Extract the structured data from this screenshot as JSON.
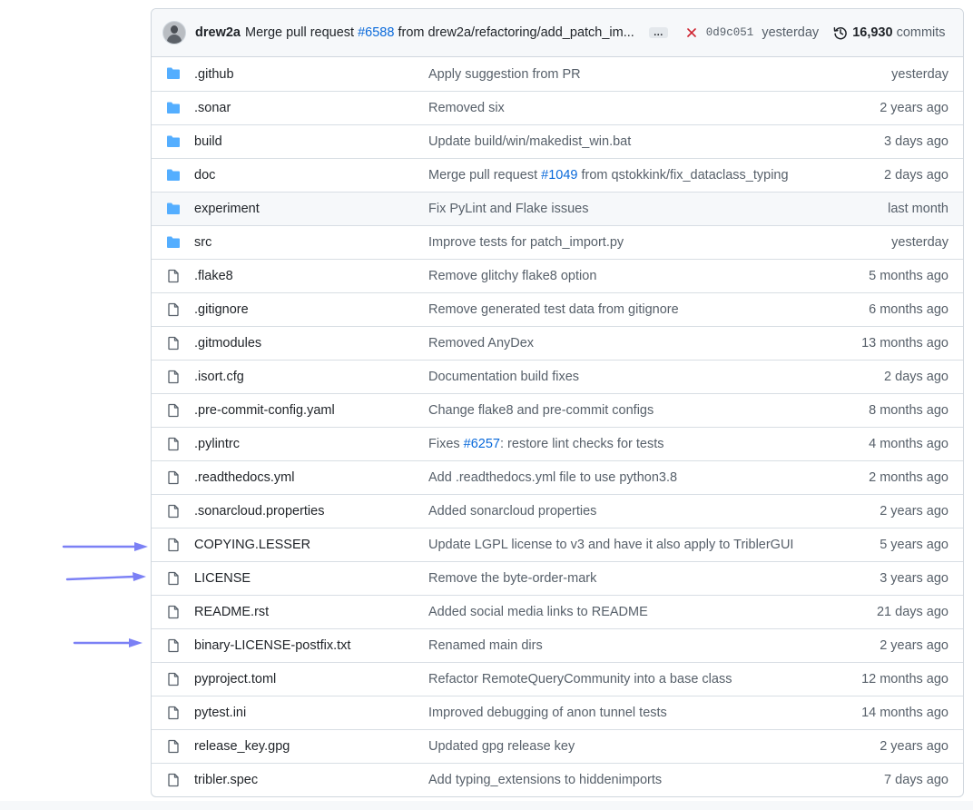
{
  "colors": {
    "folder": "#54aeff",
    "link": "#0969da",
    "arrow": "#7b80f5",
    "fail": "#cf222e"
  },
  "commit_bar": {
    "author": "drew2a",
    "message_prefix": "Merge pull request",
    "pr_link": "#6588",
    "message_suffix": "from drew2a/refactoring/add_patch_im...",
    "expand": "…",
    "status_icon": "x-icon",
    "sha": "0d9c051",
    "when": "yesterday",
    "history_icon": "history-icon",
    "commit_count": "16,930",
    "commits_label": "commits"
  },
  "files": [
    {
      "type": "dir",
      "name": ".github",
      "message": "Apply suggestion from PR",
      "age": "yesterday"
    },
    {
      "type": "dir",
      "name": ".sonar",
      "message": "Removed six",
      "age": "2 years ago"
    },
    {
      "type": "dir",
      "name": "build",
      "message": "Update build/win/makedist_win.bat",
      "age": "3 days ago"
    },
    {
      "type": "dir",
      "name": "doc",
      "message_prefix": "Merge pull request ",
      "message_link": "#1049",
      "message_suffix": " from qstokkink/fix_dataclass_typing",
      "age": "2 days ago"
    },
    {
      "type": "dir",
      "name": "experiment",
      "message": "Fix PyLint and Flake issues",
      "age": "last month"
    },
    {
      "type": "dir",
      "name": "src",
      "message": "Improve tests for patch_import.py",
      "age": "yesterday"
    },
    {
      "type": "file",
      "name": ".flake8",
      "message": "Remove glitchy flake8 option",
      "age": "5 months ago"
    },
    {
      "type": "file",
      "name": ".gitignore",
      "message": "Remove generated test data from gitignore",
      "age": "6 months ago"
    },
    {
      "type": "file",
      "name": ".gitmodules",
      "message": "Removed AnyDex",
      "age": "13 months ago"
    },
    {
      "type": "file",
      "name": ".isort.cfg",
      "message": "Documentation build fixes",
      "age": "2 days ago"
    },
    {
      "type": "file",
      "name": ".pre-commit-config.yaml",
      "message": "Change flake8 and pre-commit configs",
      "age": "8 months ago"
    },
    {
      "type": "file",
      "name": ".pylintrc",
      "message_prefix": "Fixes ",
      "message_link": "#6257",
      "message_suffix": ": restore lint checks for tests",
      "age": "4 months ago"
    },
    {
      "type": "file",
      "name": ".readthedocs.yml",
      "message": "Add .readthedocs.yml file to use python3.8",
      "age": "2 months ago"
    },
    {
      "type": "file",
      "name": ".sonarcloud.properties",
      "message": "Added sonarcloud properties",
      "age": "2 years ago"
    },
    {
      "type": "file",
      "name": "COPYING.LESSER",
      "message": "Update LGPL license to v3 and have it also apply to TriblerGUI",
      "age": "5 years ago"
    },
    {
      "type": "file",
      "name": "LICENSE",
      "message": "Remove the byte-order-mark",
      "age": "3 years ago"
    },
    {
      "type": "file",
      "name": "README.rst",
      "message": "Added social media links to README",
      "age": "21 days ago"
    },
    {
      "type": "file",
      "name": "binary-LICENSE-postfix.txt",
      "message": "Renamed main dirs",
      "age": "2 years ago"
    },
    {
      "type": "file",
      "name": "pyproject.toml",
      "message": "Refactor RemoteQueryCommunity into a base class",
      "age": "12 months ago"
    },
    {
      "type": "file",
      "name": "pytest.ini",
      "message": "Improved debugging of anon tunnel tests",
      "age": "14 months ago"
    },
    {
      "type": "file",
      "name": "release_key.gpg",
      "message": "Updated gpg release key",
      "age": "2 years ago"
    },
    {
      "type": "file",
      "name": "tribler.spec",
      "message": "Add typing_extensions to hiddenimports",
      "age": "7 days ago"
    }
  ],
  "hovered_row": "experiment",
  "annotation_arrows_point_to": [
    "COPYING.LESSER",
    "LICENSE",
    "binary-LICENSE-postfix.txt"
  ]
}
